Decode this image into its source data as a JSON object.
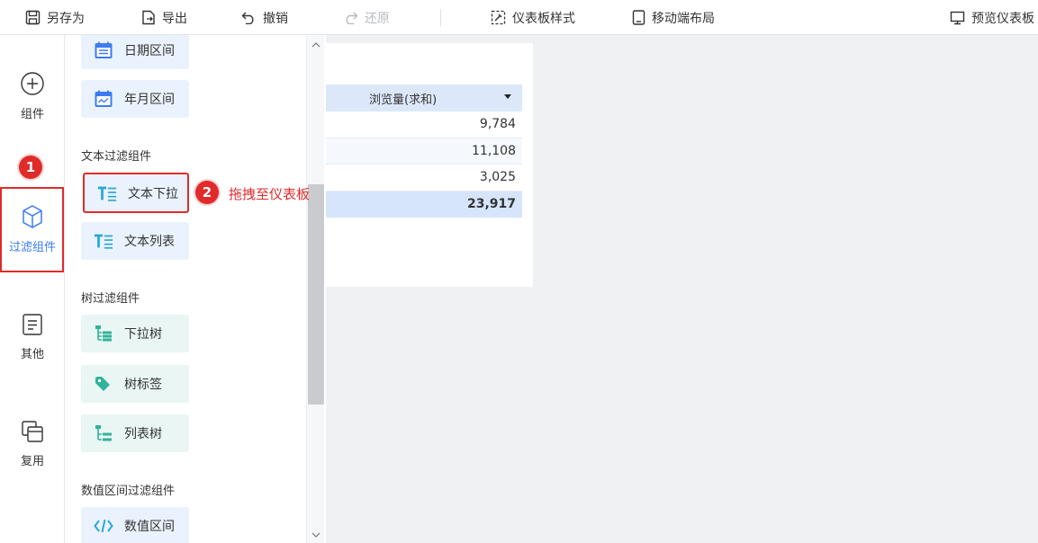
{
  "toolbar": {
    "save_as": "另存为",
    "export": "导出",
    "undo": "撤销",
    "redo": "还原",
    "dashboard_style": "仪表板样式",
    "mobile_layout": "移动端布局",
    "preview": "预览仪表板"
  },
  "rail": {
    "components": "组件",
    "filter_components": "过滤组件",
    "other": "其他",
    "reuse": "复用"
  },
  "badges": {
    "step1": "1",
    "step2": "2"
  },
  "annotation": "拖拽至仪表板",
  "panel": {
    "date_range": "日期区间",
    "year_month_range": "年月区间",
    "text_filter_title": "文本过滤组件",
    "text_dropdown": "文本下拉",
    "text_list": "文本列表",
    "tree_filter_title": "树过滤组件",
    "dropdown_tree": "下拉树",
    "tree_tag": "树标签",
    "list_tree": "列表树",
    "numeric_filter_title": "数值区间过滤组件",
    "numeric_range": "数值区间"
  },
  "table": {
    "header": "浏览量(求和)",
    "rows": [
      "9,784",
      "11,108",
      "3,025"
    ],
    "total": "23,917"
  },
  "colors": {
    "accent": "#3d7bf2",
    "highlight": "#e02b2b",
    "teal": "#2fb39a"
  }
}
